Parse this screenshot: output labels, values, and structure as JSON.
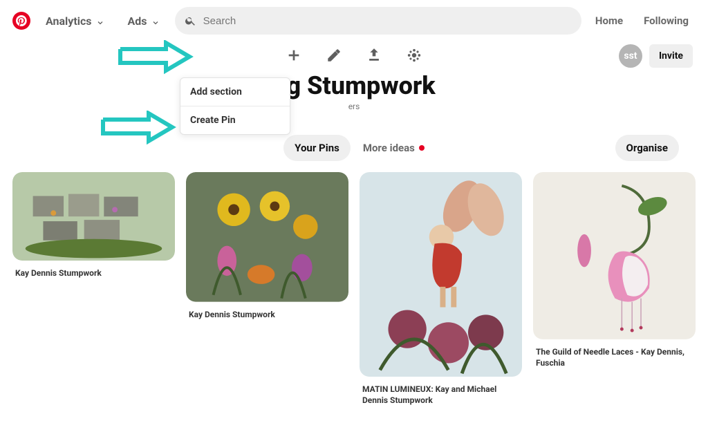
{
  "header": {
    "analytics": "Analytics",
    "ads": "Ads",
    "search_placeholder": "Search",
    "home": "Home",
    "following": "Following"
  },
  "toolbar": {
    "dropdown": {
      "add_section": "Add section",
      "create_pin": "Create Pin"
    }
  },
  "board": {
    "title": "ng Stumpwork",
    "subtitle": "ers"
  },
  "top_right": {
    "avatar_text": "sst",
    "invite": "Invite"
  },
  "tabs": {
    "your_pins": "Your Pins",
    "more_ideas": "More ideas",
    "organise": "Organise"
  },
  "pins": [
    {
      "title": "Kay Dennis Stumpwork"
    },
    {
      "title": "Kay Dennis Stumpwork"
    },
    {
      "title": "MATIN LUMINEUX: Kay and Michael Dennis Stumpwork"
    },
    {
      "title": "The Guild of Needle Laces - Kay Dennis, Fuschia"
    }
  ]
}
